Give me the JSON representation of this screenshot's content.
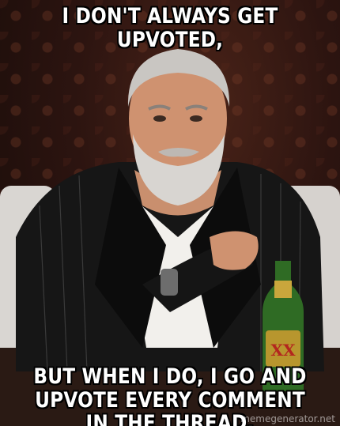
{
  "meme": {
    "top_text": "I DON'T ALWAYS GET UPVOTED,",
    "bottom_text": "BUT WHEN I DO, I GO AND UPVOTE EVERY COMMENT IN THE THREAD.",
    "watermark": "memegenerator.net"
  },
  "colors": {
    "caption": "#ffffff",
    "caption_outline": "#000000",
    "background": "#2c1410"
  }
}
